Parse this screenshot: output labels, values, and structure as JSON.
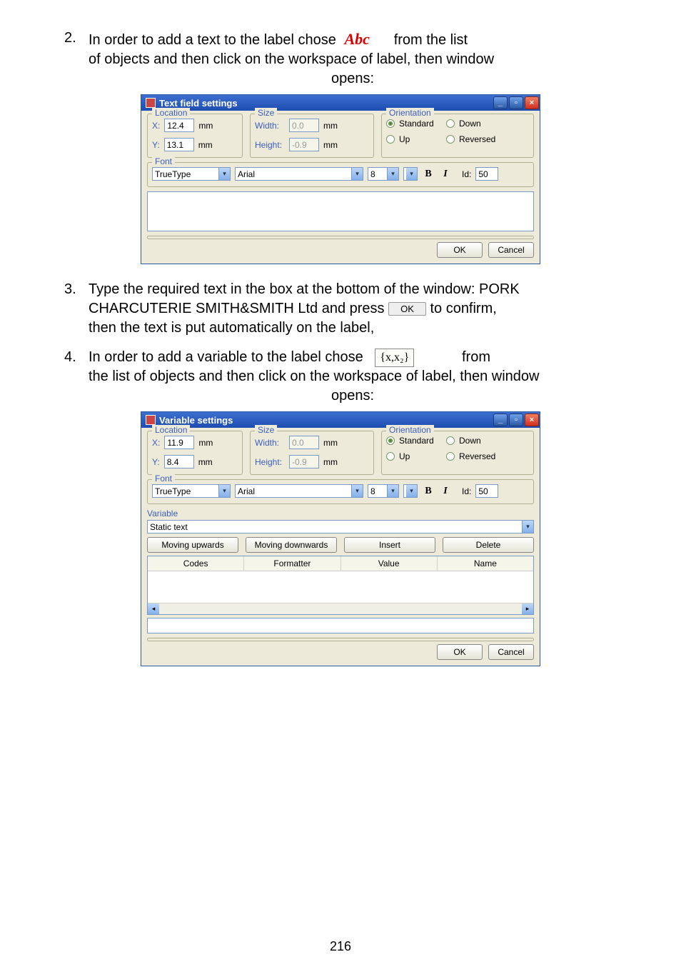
{
  "instructions": {
    "step2": {
      "num": "2.",
      "line1a": "In order to add a text to the label chose",
      "abc": "Abc",
      "line1b": "from the list",
      "line2": "of objects and then click on the workspace of label, then window",
      "line3": "opens:"
    },
    "step3": {
      "num": "3.",
      "line1": "Type the required text in the box at the bottom of the window: PORK",
      "line2a": "CHARCUTERIE SMITH&SMITH Ltd and press",
      "ok": "OK",
      "line2b": "to confirm,",
      "line3": "then the text is put automatically on the label,"
    },
    "step4": {
      "num": "4.",
      "line1a": "In order to add a variable to the label chose",
      "varsym": "{x,x₂}",
      "line1b": "from",
      "line2": "the list of objects and then click on the workspace of label, then window",
      "line3": "opens:"
    }
  },
  "dialog1": {
    "title": "Text field settings",
    "location_legend": "Location",
    "x_label": "X:",
    "x_value": "12.4",
    "mm": "mm",
    "y_label": "Y:",
    "y_value": "13.1",
    "size_legend": "Size",
    "width_label": "Width:",
    "width_value": "0.0",
    "height_label": "Height:",
    "height_value": "-0.9",
    "orientation_legend": "Orientation",
    "standard": "Standard",
    "up": "Up",
    "down": "Down",
    "reversed": "Reversed",
    "font_legend": "Font",
    "font_type": "TrueType",
    "font_name": "Arial",
    "font_size": "8",
    "bold": "B",
    "italic": "I",
    "id_label": "Id:",
    "id_value": "50",
    "ok": "OK",
    "cancel": "Cancel"
  },
  "dialog2": {
    "title": "Variable settings",
    "location_legend": "Location",
    "x_label": "X:",
    "x_value": "11.9",
    "mm": "mm",
    "y_label": "Y:",
    "y_value": "8.4",
    "size_legend": "Size",
    "width_label": "Width:",
    "width_value": "0.0",
    "height_label": "Height:",
    "height_value": "-0.9",
    "orientation_legend": "Orientation",
    "standard": "Standard",
    "up": "Up",
    "down": "Down",
    "reversed": "Reversed",
    "font_legend": "Font",
    "font_type": "TrueType",
    "font_name": "Arial",
    "font_size": "8",
    "bold": "B",
    "italic": "I",
    "id_label": "Id:",
    "id_value": "50",
    "variable_legend": "Variable",
    "static_text": "Static text",
    "moving_up": "Moving upwards",
    "moving_down": "Moving downwards",
    "insert": "Insert",
    "delete": "Delete",
    "col_codes": "Codes",
    "col_formatter": "Formatter",
    "col_value": "Value",
    "col_name": "Name",
    "ok": "OK",
    "cancel": "Cancel"
  },
  "page_number": "216"
}
